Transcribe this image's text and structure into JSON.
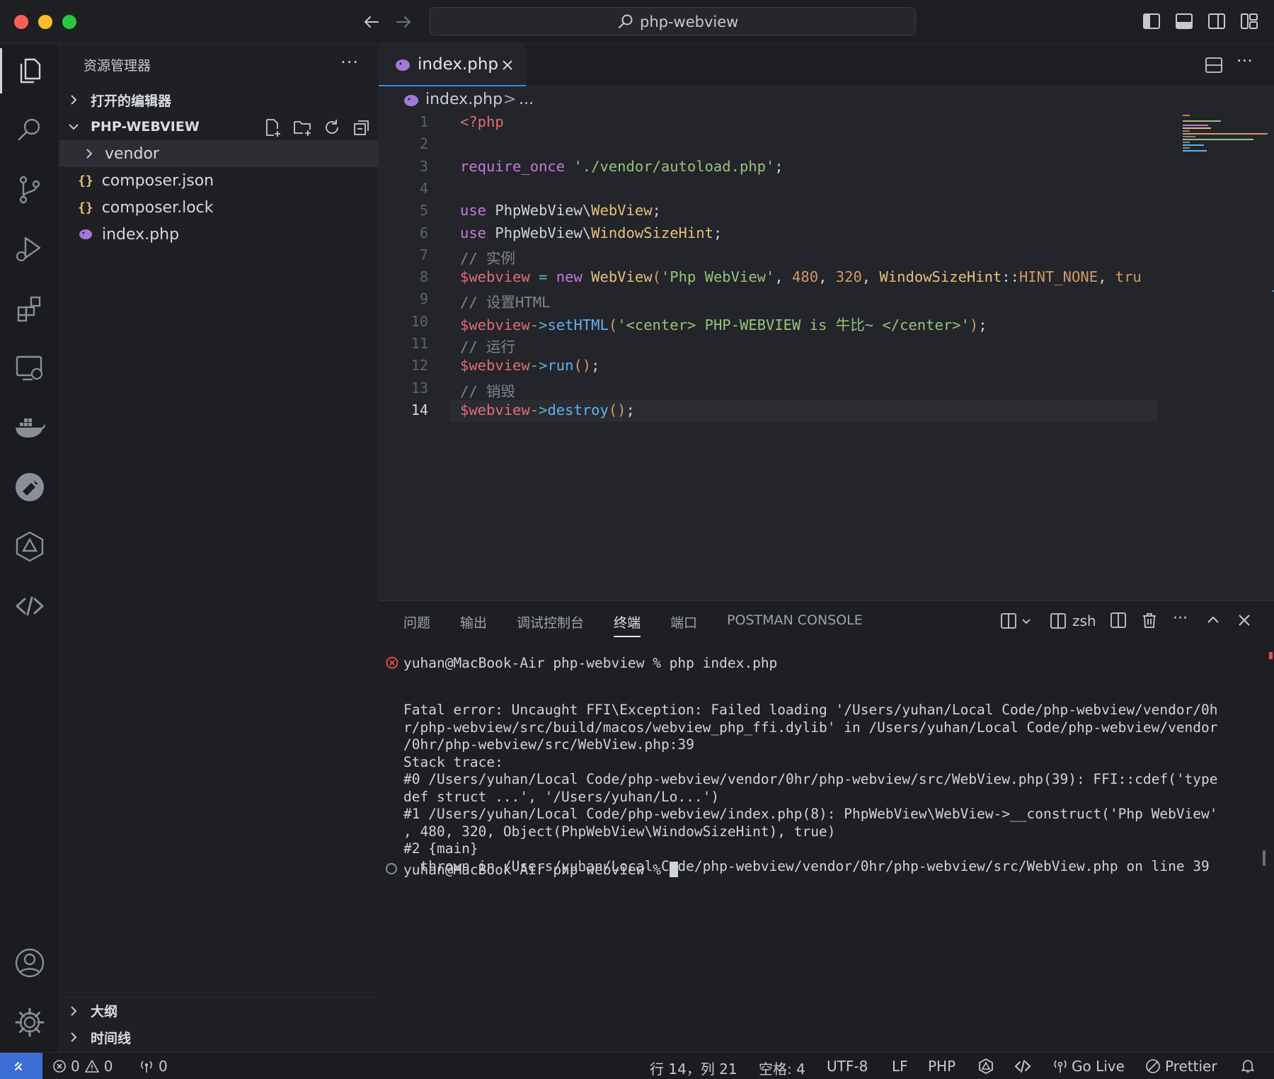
{
  "window": {
    "title": "php-webview"
  },
  "explorer": {
    "title": "资源管理器",
    "more": "···",
    "open_editors": "打开的编辑器",
    "project": "PHP-WEBVIEW",
    "files": [
      {
        "name": "vendor",
        "type": "folder"
      },
      {
        "name": "composer.json",
        "type": "json"
      },
      {
        "name": "composer.lock",
        "type": "json"
      },
      {
        "name": "index.php",
        "type": "php"
      }
    ],
    "outline": "大纲",
    "timeline": "时间线"
  },
  "editor": {
    "tab_label": "index.php",
    "breadcrumb_file": "index.php",
    "breadcrumb_sep": ">",
    "breadcrumb_rest": "...",
    "more": "···",
    "line_numbers": [
      "1",
      "2",
      "3",
      "4",
      "5",
      "6",
      "7",
      "8",
      "9",
      "10",
      "11",
      "12",
      "13",
      "14"
    ],
    "current_line": 14
  },
  "panel": {
    "tabs": [
      "问题",
      "输出",
      "调试控制台",
      "终端",
      "端口",
      "POSTMAN CONSOLE"
    ],
    "active_tab": "终端",
    "shell": "zsh",
    "more": "···",
    "terminal_lines": [
      "yuhan@MacBook-Air php-webview % php index.php",
      "",
      "Fatal error: Uncaught FFI\\Exception: Failed loading '/Users/yuhan/Local Code/php-webview/vendor/0h",
      "r/php-webview/src/build/macos/webview_php_ffi.dylib' in /Users/yuhan/Local Code/php-webview/vendor",
      "/0hr/php-webview/src/WebView.php:39",
      "Stack trace:",
      "#0 /Users/yuhan/Local Code/php-webview/vendor/0hr/php-webview/src/WebView.php(39): FFI::cdef('type",
      "def struct ...', '/Users/yuhan/Lo...')",
      "#1 /Users/yuhan/Local Code/php-webview/index.php(8): PhpWebView\\WebView->__construct('Php WebView'",
      ", 480, 320, Object(PhpWebView\\WindowSizeHint), true)",
      "#2 {main}",
      "  thrown in /Users/yuhan/Local Code/php-webview/vendor/0hr/php-webview/src/WebView.php on line 39"
    ],
    "prompt": "yuhan@MacBook-Air php-webview % "
  },
  "status": {
    "errors": "0",
    "warnings": "0",
    "ports": "0",
    "position": "行 14，列 21",
    "spaces": "空格: 4",
    "encoding": "UTF-8",
    "eol": "LF",
    "language": "PHP",
    "go_live": "Go Live",
    "prettier": "Prettier"
  },
  "colors": {
    "accent": "#3b82f6",
    "error": "#f14c4c",
    "php": "#a279d8",
    "json": "#e5c07b"
  }
}
